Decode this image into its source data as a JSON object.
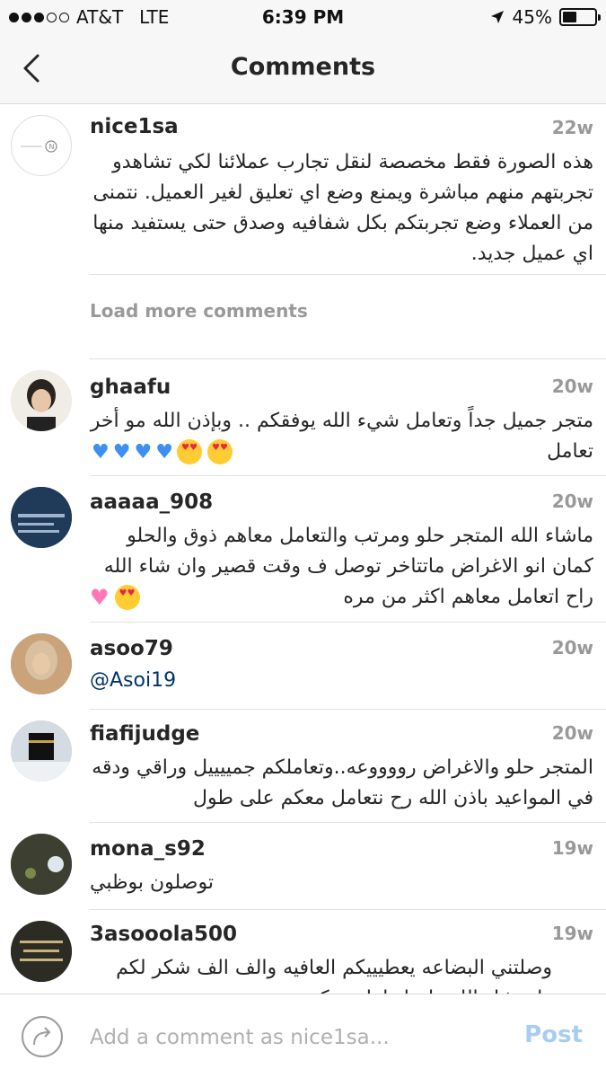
{
  "status_bar": {
    "carrier": "AT&T",
    "network": "LTE",
    "time": "6:39 PM",
    "battery": "45%",
    "battery_level": 0.45
  },
  "header": {
    "title": "Comments",
    "back_icon": "chevron-left-icon"
  },
  "caption": {
    "username": "nice1sa",
    "time": "22w",
    "text": "هذه الصورة فقط مخصصة لنقل تجارب عملائنا لكي تشاهدو تجربتهم منهم مباشرة ويمنع وضع اي تعليق لغير العميل. نتمنى من العملاء وضع تجربتكم بكل شفافيه وصدق حتى يستفيد منها اي عميل جديد."
  },
  "load_more": {
    "label": "Load more comments"
  },
  "comments": [
    {
      "username": "ghaafu",
      "time": "20w",
      "text": "متجر جميل جداً وتعامل شيء الله يوفقكم .. وبإذن الله مو أخر تعامل"
    },
    {
      "username": "aaaaa_908",
      "time": "20w",
      "text": "ماشاء الله المتجر حلو ومرتب والتعامل معاهم ذوق والحلو كمان انو الاغراض ماتتاخر توصل ف وقت قصير وان شاء الله راح اتعامل معاهم اكثر من مره"
    },
    {
      "username": "asoo79",
      "time": "20w",
      "text": "@Asoi19"
    },
    {
      "username": "fiafijudge",
      "time": "20w",
      "text": "المتجر حلو والاغراض رووووعه..وتعاملكم جمييييل وراقي ودقه في المواعيد باذن الله رح نتعامل معكم على طول"
    },
    {
      "username": "mona_s92",
      "time": "19w",
      "text": "توصلون بوظبي"
    },
    {
      "username": "3asooola500",
      "time": "19w",
      "text": "وصلتني البضاعه يعطيييكم العافيه والف الف شكر لكم وان شاء الله راح اتعامل معكم"
    }
  ],
  "input_bar": {
    "placeholder": "Add a comment as nice1sa...",
    "post_label": "Post"
  },
  "colors": {
    "accent_disabled": "#a8cdf5",
    "mention": "#003569",
    "timestamp": "#999999"
  }
}
